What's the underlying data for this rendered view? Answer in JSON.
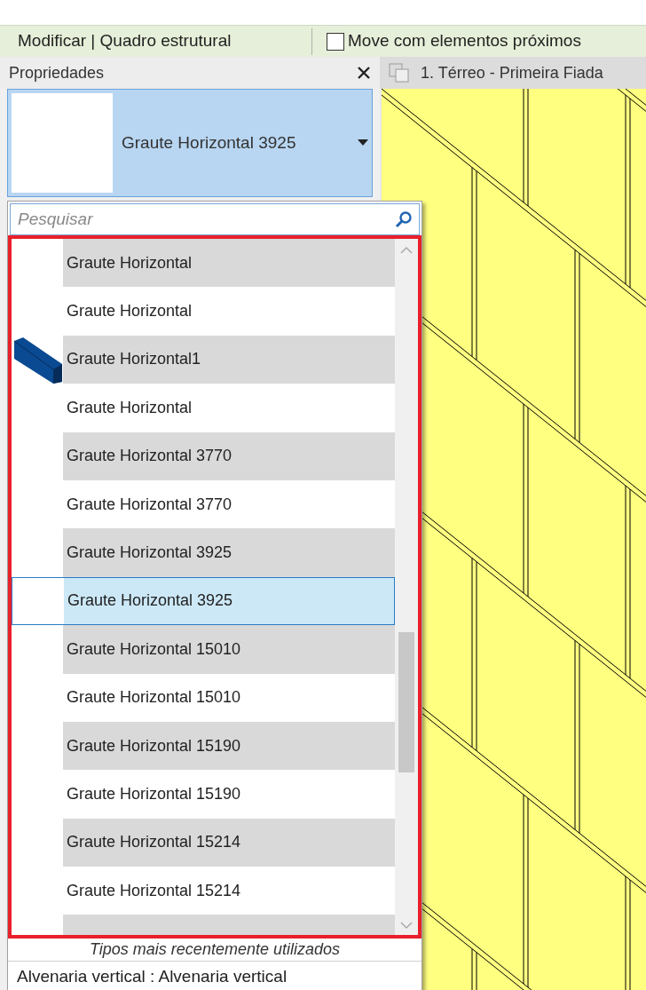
{
  "ribbon": {
    "context_label": "Modificar | Quadro estrutural",
    "option": {
      "label": "Move com elementos próximos",
      "checked": false
    }
  },
  "properties": {
    "title": "Propriedades",
    "type_selector": {
      "value": "Graute Horizontal 3925"
    }
  },
  "view_tab": {
    "title": "1. Térreo - Primeira Fiada"
  },
  "dropdown": {
    "search": {
      "placeholder": "Pesquisar"
    },
    "items": [
      {
        "label": "Graute Horizontal",
        "kind": "blank-preview",
        "selected": false
      },
      {
        "label": "Graute Horizontal",
        "kind": "plain",
        "selected": false
      },
      {
        "label": "Graute Horizontal1",
        "kind": "beam-preview",
        "selected": false
      },
      {
        "label": "Graute Horizontal",
        "kind": "plain",
        "selected": false
      },
      {
        "label": "Graute Horizontal 3770",
        "kind": "blank-preview",
        "selected": false
      },
      {
        "label": "Graute Horizontal 3770",
        "kind": "plain",
        "selected": false
      },
      {
        "label": "Graute Horizontal 3925",
        "kind": "blank-preview",
        "selected": false
      },
      {
        "label": "Graute Horizontal 3925",
        "kind": "plain",
        "selected": true
      },
      {
        "label": "Graute Horizontal 15010",
        "kind": "blank-preview",
        "selected": false
      },
      {
        "label": "Graute Horizontal 15010",
        "kind": "plain",
        "selected": false
      },
      {
        "label": "Graute Horizontal 15190",
        "kind": "blank-preview",
        "selected": false
      },
      {
        "label": "Graute Horizontal 15190",
        "kind": "plain",
        "selected": false
      },
      {
        "label": "Graute Horizontal 15214",
        "kind": "blank-preview",
        "selected": false
      },
      {
        "label": "Graute Horizontal 15214",
        "kind": "plain",
        "selected": false
      }
    ],
    "recent_heading": "Tipos mais recentemente utilizados",
    "recent_items": [
      "Alvenaria vertical : Alvenaria vertical"
    ]
  }
}
